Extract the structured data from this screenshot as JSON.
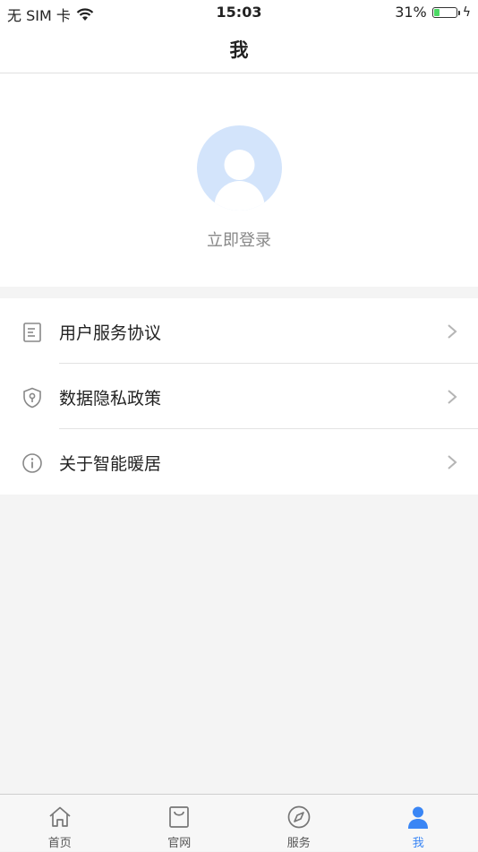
{
  "status_bar": {
    "carrier": "无 SIM 卡",
    "time": "15:03",
    "battery_percent": "31%",
    "battery_level": 0.31,
    "battery_color": "#4cd964"
  },
  "nav": {
    "title": "我"
  },
  "profile": {
    "avatar_icon": "user-avatar-placeholder",
    "avatar_color": "#d3e4fb",
    "login_label": "立即登录"
  },
  "menu": {
    "items": [
      {
        "label": "用户服务协议",
        "icon": "document-icon"
      },
      {
        "label": "数据隐私政策",
        "icon": "shield-icon"
      },
      {
        "label": "关于智能暖居",
        "icon": "info-icon"
      }
    ]
  },
  "tabbar": {
    "active_color": "#3a86f5",
    "tabs": [
      {
        "label": "首页",
        "icon": "home-icon"
      },
      {
        "label": "官网",
        "icon": "shopping-bag-icon"
      },
      {
        "label": "服务",
        "icon": "compass-icon"
      },
      {
        "label": "我",
        "icon": "person-icon",
        "active": true
      }
    ]
  }
}
